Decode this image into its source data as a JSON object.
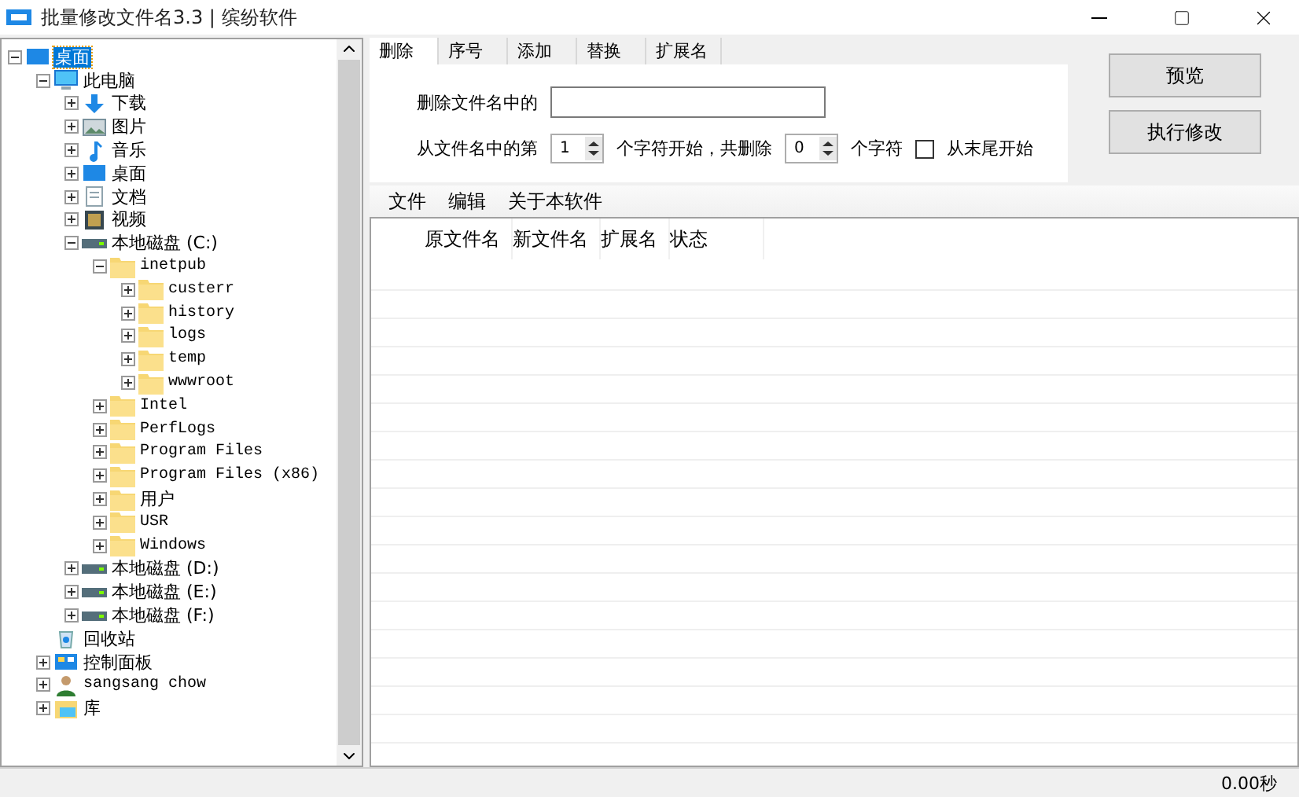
{
  "window": {
    "title": "批量修改文件名3.3 | 缤纷软件"
  },
  "tree": [
    {
      "label": "桌面",
      "kind": "desktop",
      "selected": true,
      "expanded": true,
      "children": [
        {
          "label": "此电脑",
          "kind": "computer",
          "selected": false,
          "expanded": true,
          "children": [
            {
              "label": "下载",
              "kind": "download",
              "selected": false,
              "expanded": false
            },
            {
              "label": "图片",
              "kind": "picture",
              "selected": false,
              "expanded": false
            },
            {
              "label": "音乐",
              "kind": "music",
              "selected": false,
              "expanded": false
            },
            {
              "label": "桌面",
              "kind": "desktop",
              "selected": false,
              "expanded": false
            },
            {
              "label": "文档",
              "kind": "document",
              "selected": false,
              "expanded": false
            },
            {
              "label": "视频",
              "kind": "video",
              "selected": false,
              "expanded": false
            },
            {
              "label": "本地磁盘 (C:)",
              "kind": "drive",
              "selected": false,
              "expanded": true,
              "children": [
                {
                  "label": "inetpub",
                  "kind": "folder",
                  "selected": false,
                  "expanded": true,
                  "children": [
                    {
                      "label": "custerr",
                      "kind": "folder",
                      "selected": false,
                      "expanded": false
                    },
                    {
                      "label": "history",
                      "kind": "folder",
                      "selected": false,
                      "expanded": false
                    },
                    {
                      "label": "logs",
                      "kind": "folder",
                      "selected": false,
                      "expanded": false
                    },
                    {
                      "label": "temp",
                      "kind": "folder",
                      "selected": false,
                      "expanded": false
                    },
                    {
                      "label": "wwwroot",
                      "kind": "folder",
                      "selected": false,
                      "expanded": false
                    }
                  ]
                },
                {
                  "label": "Intel",
                  "kind": "folder",
                  "selected": false,
                  "expanded": false
                },
                {
                  "label": "PerfLogs",
                  "kind": "folder",
                  "selected": false,
                  "expanded": false
                },
                {
                  "label": "Program Files",
                  "kind": "folder",
                  "selected": false,
                  "expanded": false
                },
                {
                  "label": "Program Files (x86)",
                  "kind": "folder",
                  "selected": false,
                  "expanded": false
                },
                {
                  "label": "用户",
                  "kind": "folder",
                  "selected": false,
                  "expanded": false
                },
                {
                  "label": "USR",
                  "kind": "folder",
                  "selected": false,
                  "expanded": false
                },
                {
                  "label": "Windows",
                  "kind": "folder",
                  "selected": false,
                  "expanded": false
                }
              ]
            },
            {
              "label": "本地磁盘 (D:)",
              "kind": "drive",
              "selected": false,
              "expanded": false
            },
            {
              "label": "本地磁盘 (E:)",
              "kind": "drive",
              "selected": false,
              "expanded": false
            },
            {
              "label": "本地磁盘 (F:)",
              "kind": "drive",
              "selected": false,
              "expanded": false
            }
          ]
        },
        {
          "label": "回收站",
          "kind": "recycle",
          "selected": false
        },
        {
          "label": "控制面板",
          "kind": "control",
          "selected": false,
          "expanded": false
        },
        {
          "label": "sangsang chow",
          "kind": "user",
          "selected": false,
          "expanded": false
        },
        {
          "label": "库",
          "kind": "library",
          "selected": false,
          "expanded": false
        }
      ]
    }
  ],
  "tabs": [
    {
      "label": "删除",
      "selected": true
    },
    {
      "label": "序号",
      "selected": false
    },
    {
      "label": "添加",
      "selected": false
    },
    {
      "label": "替换",
      "selected": false
    },
    {
      "label": "扩展名",
      "selected": false
    }
  ],
  "delete_panel": {
    "name_label": "删除文件名中的",
    "start_label": "从文件名中的第",
    "start_value": "1",
    "mid_label": "个字符开始，共删除",
    "count_value": "0",
    "end_label": "个字符",
    "from_end": {
      "label": "从末尾开始",
      "checked": false
    }
  },
  "buttons": [
    "预览",
    "执行修改"
  ],
  "menu": [
    "文件",
    "编辑",
    "关于本软件"
  ],
  "table": {
    "columns": [
      "原文件名",
      "新文件名",
      "扩展名",
      "状态"
    ]
  },
  "status_bar": {
    "time": "0.00秒"
  }
}
